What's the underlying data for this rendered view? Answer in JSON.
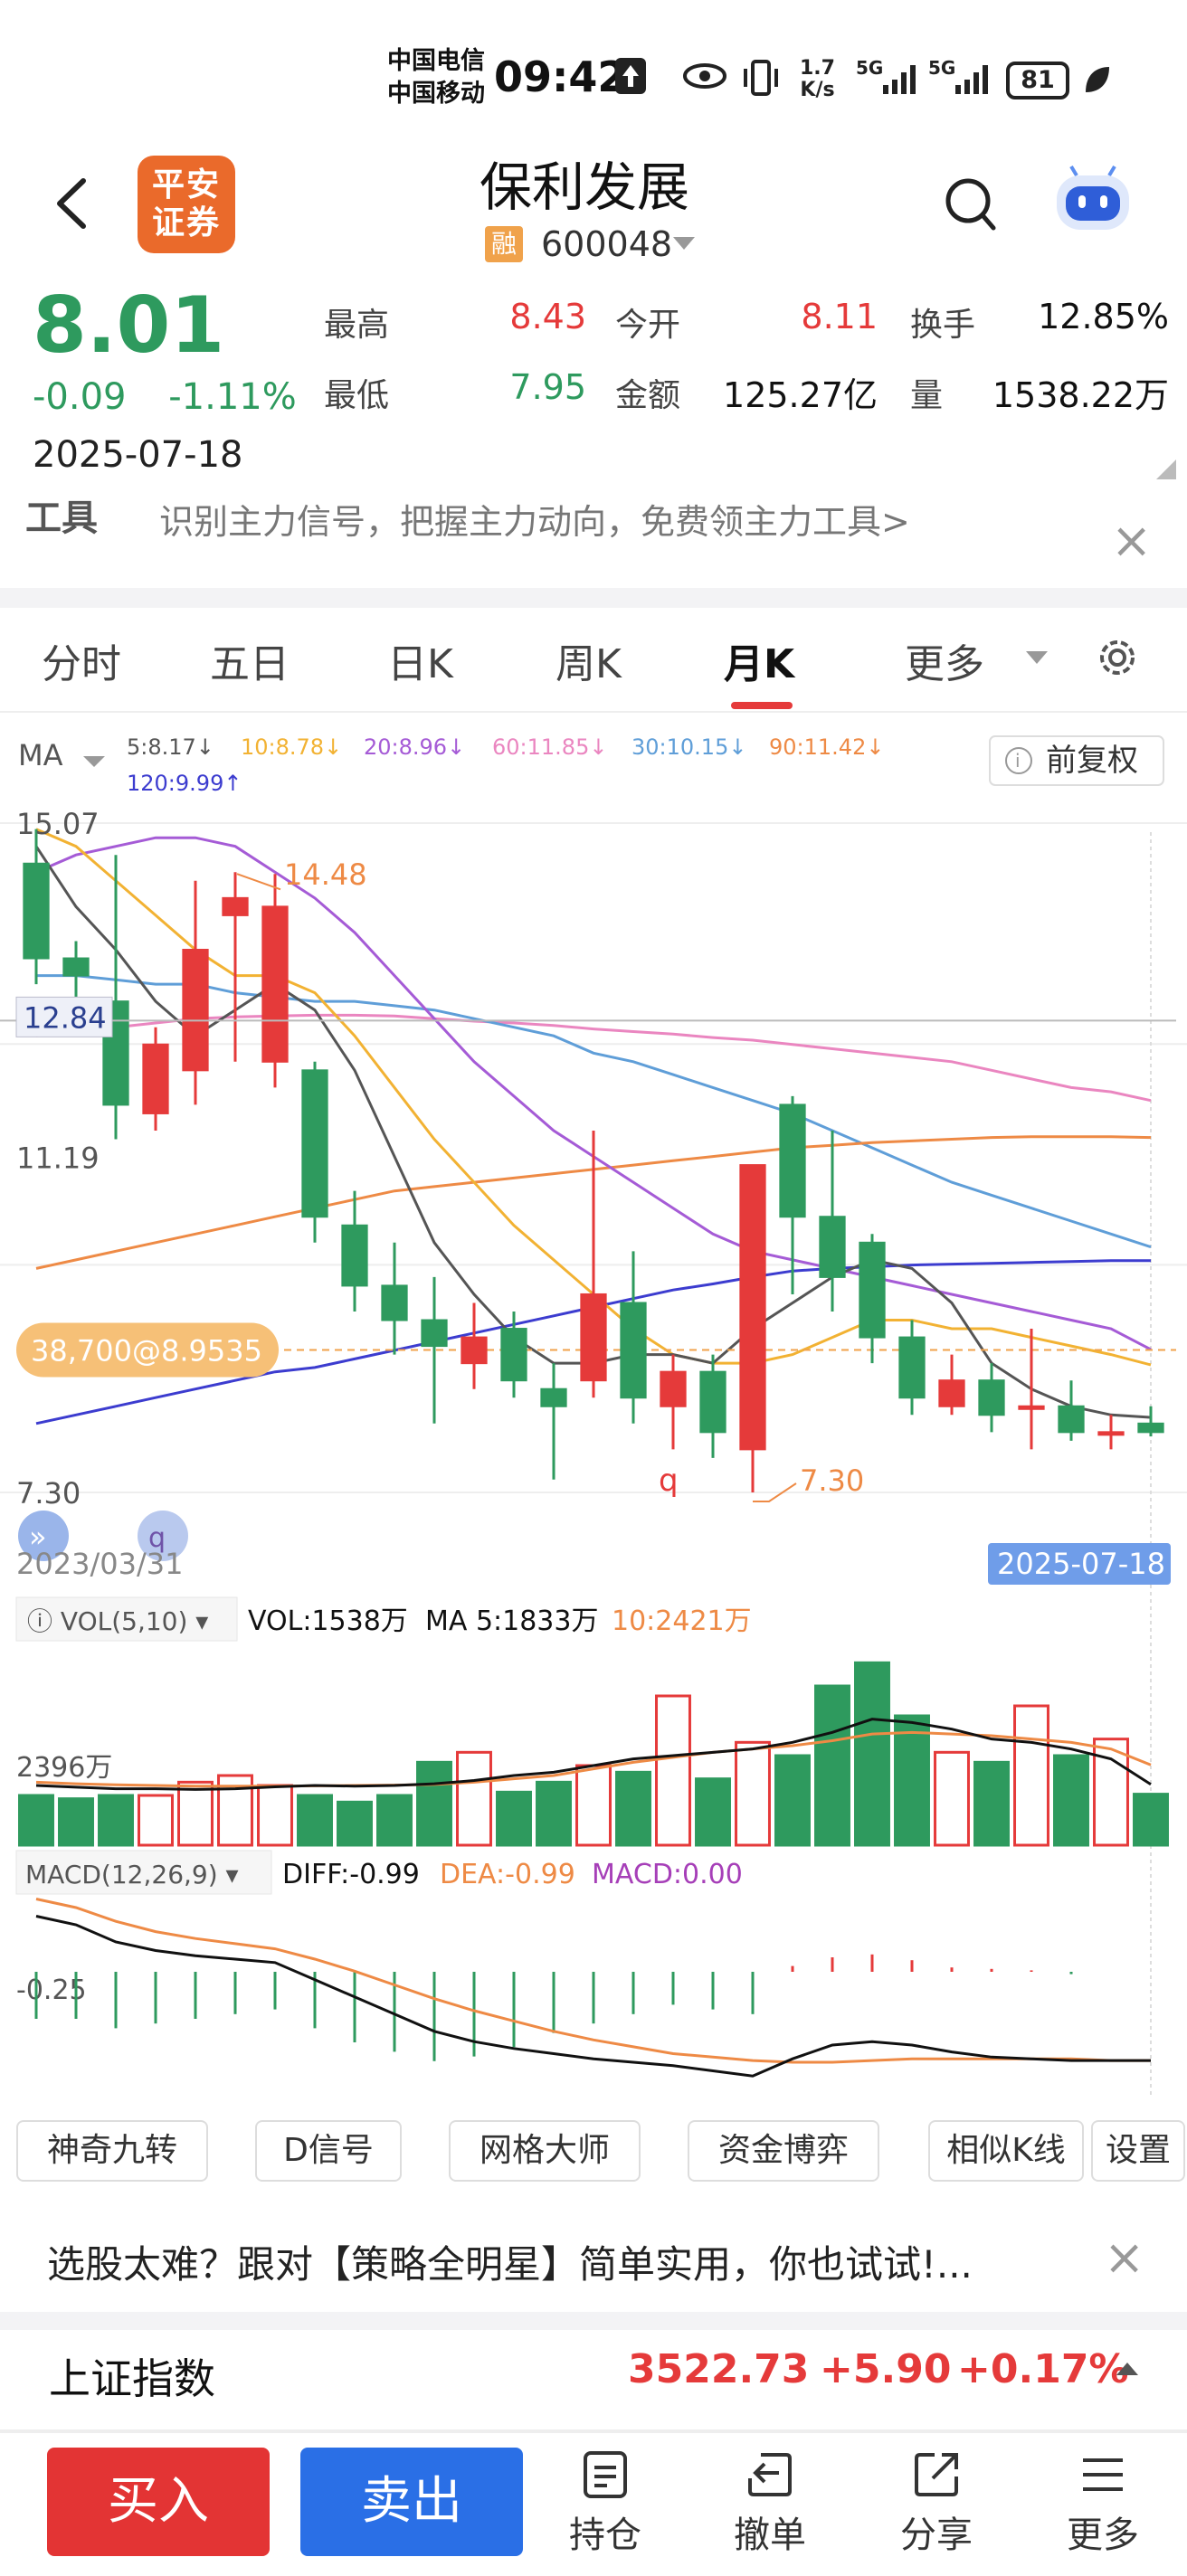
{
  "status_bar": {
    "carrier1": "中国电信",
    "carrier2": "中国移动",
    "time": "09:42",
    "net_speed_value": "1.7",
    "net_speed_unit": "K/s",
    "battery": "81",
    "icons": [
      "upload-icon",
      "eye-icon",
      "vibrate-icon",
      "signal-5g-icon",
      "signal-5g-icon",
      "battery-icon",
      "leaf-icon"
    ]
  },
  "header": {
    "broker_logo_line1": "平安",
    "broker_logo_line2": "证券",
    "stock_name": "保利发展",
    "margin_badge": "融",
    "stock_code": "600048"
  },
  "quote": {
    "price": "8.01",
    "change": "-0.09",
    "change_pct": "-1.11%",
    "date": "2025-07-18",
    "high_label": "最高",
    "high": "8.43",
    "low_label": "最低",
    "low": "7.95",
    "open_label": "今开",
    "open": "8.11",
    "amount_label": "金额",
    "amount": "125.27亿",
    "turnover_label": "换手",
    "turnover": "12.85%",
    "volume_label": "量",
    "volume": "1538.22万"
  },
  "promo": {
    "label": "工具",
    "text": "识别主力信号，把握主力动向，免费领主力工具>"
  },
  "tabs": [
    "分时",
    "五日",
    "日K",
    "周K",
    "月K",
    "更多"
  ],
  "active_tab": "月K",
  "chart_data": {
    "type": "candlestick",
    "period": "monthly",
    "ma_label": "MA",
    "ma_legend": [
      {
        "label": "5:8.17",
        "arrow": "↓",
        "color": "#555555"
      },
      {
        "label": "10:8.78",
        "arrow": "↓",
        "color": "#f2b233"
      },
      {
        "label": "20:8.96",
        "arrow": "↓",
        "color": "#a55bd6"
      },
      {
        "label": "60:11.85",
        "arrow": "↓",
        "color": "#ea86c0"
      },
      {
        "label": "30:10.15",
        "arrow": "↓",
        "color": "#5f9ed8"
      },
      {
        "label": "90:11.42",
        "arrow": "↓",
        "color": "#ee8a45"
      },
      {
        "label": "120:9.99",
        "arrow": "↑",
        "color": "#3c3ccf"
      }
    ],
    "fq_button": "前复权",
    "y_ticks": [
      "15.07",
      "11.19",
      "7.30"
    ],
    "ylim": [
      7.3,
      15.07
    ],
    "crosshair_value": "12.84",
    "marker_high": "14.48",
    "marker_low": "7.30",
    "cost_badge": "38,700@8.9535",
    "cost_price": 8.9535,
    "q_label": "q",
    "x_start": "2023/03/31",
    "x_end": "2025-07-18",
    "candles": [
      {
        "o": 14.6,
        "c": 13.5,
        "h": 15.0,
        "l": 13.2
      },
      {
        "o": 13.5,
        "c": 13.3,
        "h": 13.7,
        "l": 13.0
      },
      {
        "o": 13.0,
        "c": 11.8,
        "h": 14.7,
        "l": 11.4
      },
      {
        "o": 11.7,
        "c": 12.5,
        "h": 12.7,
        "l": 11.5
      },
      {
        "o": 12.2,
        "c": 13.6,
        "h": 14.4,
        "l": 11.8
      },
      {
        "o": 14.0,
        "c": 14.2,
        "h": 14.5,
        "l": 12.3
      },
      {
        "o": 12.3,
        "c": 14.1,
        "h": 14.48,
        "l": 12.0
      },
      {
        "o": 12.2,
        "c": 10.5,
        "h": 12.3,
        "l": 10.2
      },
      {
        "o": 10.4,
        "c": 9.7,
        "h": 10.8,
        "l": 9.4
      },
      {
        "o": 9.7,
        "c": 9.3,
        "h": 10.2,
        "l": 8.9
      },
      {
        "o": 9.3,
        "c": 9.0,
        "h": 9.8,
        "l": 8.1
      },
      {
        "o": 8.8,
        "c": 9.1,
        "h": 9.5,
        "l": 8.5
      },
      {
        "o": 9.2,
        "c": 8.6,
        "h": 9.4,
        "l": 8.4
      },
      {
        "o": 8.5,
        "c": 8.3,
        "h": 8.8,
        "l": 7.45
      },
      {
        "o": 8.6,
        "c": 9.6,
        "h": 11.5,
        "l": 8.4
      },
      {
        "o": 9.5,
        "c": 8.4,
        "h": 10.1,
        "l": 8.1
      },
      {
        "o": 8.3,
        "c": 8.7,
        "h": 8.9,
        "l": 7.8
      },
      {
        "o": 8.7,
        "c": 8.0,
        "h": 8.9,
        "l": 7.7
      },
      {
        "o": 7.8,
        "c": 11.1,
        "h": 11.1,
        "l": 7.3
      },
      {
        "o": 11.8,
        "c": 10.5,
        "h": 11.9,
        "l": 9.6
      },
      {
        "o": 10.5,
        "c": 9.8,
        "h": 11.5,
        "l": 9.4
      },
      {
        "o": 10.2,
        "c": 9.1,
        "h": 10.3,
        "l": 8.8
      },
      {
        "o": 9.1,
        "c": 8.4,
        "h": 9.3,
        "l": 8.2
      },
      {
        "o": 8.3,
        "c": 8.6,
        "h": 8.9,
        "l": 8.2
      },
      {
        "o": 8.6,
        "c": 8.2,
        "h": 8.8,
        "l": 8.0
      },
      {
        "o": 8.3,
        "c": 8.3,
        "h": 9.2,
        "l": 7.8
      },
      {
        "o": 8.3,
        "c": 8.0,
        "h": 8.6,
        "l": 7.9
      },
      {
        "o": 8.0,
        "c": 8.0,
        "h": 8.2,
        "l": 7.8
      },
      {
        "o": 8.1,
        "c": 8.0,
        "h": 8.3,
        "l": 7.95
      }
    ],
    "ma_lines": {
      "ma5": [
        14.8,
        14.1,
        13.6,
        13.0,
        12.6,
        12.9,
        13.2,
        12.9,
        12.2,
        11.2,
        10.2,
        9.6,
        9.1,
        8.8,
        8.8,
        8.9,
        8.9,
        8.8,
        9.2,
        9.5,
        9.8,
        10.0,
        9.9,
        9.5,
        8.8,
        8.5,
        8.3,
        8.2,
        8.17
      ],
      "ma10": [
        15.0,
        14.8,
        14.4,
        14.0,
        13.6,
        13.3,
        13.3,
        13.1,
        12.6,
        12.0,
        11.4,
        10.9,
        10.4,
        10.0,
        9.6,
        9.2,
        8.9,
        8.8,
        8.8,
        8.9,
        9.1,
        9.3,
        9.3,
        9.2,
        9.2,
        9.1,
        9.0,
        8.9,
        8.78
      ],
      "ma20": [
        14.5,
        14.7,
        14.8,
        14.9,
        14.9,
        14.8,
        14.5,
        14.2,
        13.8,
        13.3,
        12.8,
        12.3,
        11.9,
        11.5,
        11.2,
        10.9,
        10.6,
        10.3,
        10.1,
        10.0,
        9.9,
        9.8,
        9.7,
        9.6,
        9.5,
        9.4,
        9.3,
        9.2,
        8.96
      ],
      "ma30": [
        13.3,
        13.3,
        13.25,
        13.2,
        13.2,
        13.1,
        13.05,
        13.0,
        13.0,
        12.95,
        12.9,
        12.8,
        12.7,
        12.6,
        12.4,
        12.3,
        12.15,
        12.0,
        11.85,
        11.7,
        11.5,
        11.3,
        11.1,
        10.9,
        10.75,
        10.6,
        10.45,
        10.3,
        10.15
      ],
      "ma60": [
        12.6,
        12.65,
        12.7,
        12.75,
        12.8,
        12.82,
        12.83,
        12.84,
        12.84,
        12.83,
        12.8,
        12.77,
        12.75,
        12.72,
        12.68,
        12.65,
        12.62,
        12.58,
        12.55,
        12.5,
        12.45,
        12.4,
        12.35,
        12.3,
        12.2,
        12.1,
        12.0,
        11.95,
        11.85
      ],
      "ma90": [
        9.9,
        10.0,
        10.1,
        10.2,
        10.3,
        10.4,
        10.5,
        10.6,
        10.7,
        10.8,
        10.85,
        10.9,
        10.95,
        11.0,
        11.05,
        11.1,
        11.15,
        11.2,
        11.25,
        11.3,
        11.33,
        11.36,
        11.38,
        11.4,
        11.42,
        11.43,
        11.43,
        11.43,
        11.42
      ],
      "ma120": [
        8.1,
        8.2,
        8.3,
        8.4,
        8.5,
        8.6,
        8.7,
        8.75,
        8.85,
        8.95,
        9.05,
        9.15,
        9.25,
        9.35,
        9.45,
        9.55,
        9.65,
        9.72,
        9.8,
        9.87,
        9.9,
        9.92,
        9.94,
        9.95,
        9.96,
        9.97,
        9.98,
        9.99,
        9.99
      ]
    },
    "volume": {
      "indicator": "VOL(5,10)",
      "legend_vol": "VOL:1538万",
      "legend_ma5": "MA 5:1833万",
      "legend_ma10": "10:2421万",
      "y_tick": "2396万",
      "values": [
        1500,
        1400,
        1500,
        1500,
        1900,
        2100,
        1800,
        1500,
        1300,
        1500,
        2500,
        2800,
        1600,
        1900,
        2400,
        2200,
        4500,
        2000,
        3100,
        2700,
        4800,
        5500,
        3900,
        2800,
        2500,
        4200,
        2700,
        3200,
        1538
      ],
      "ma5": [
        1800,
        1750,
        1700,
        1700,
        1680,
        1700,
        1760,
        1800,
        1780,
        1800,
        1850,
        1950,
        2100,
        2200,
        2400,
        2600,
        2700,
        2800,
        2900,
        3100,
        3400,
        3800,
        3700,
        3500,
        3200,
        3100,
        2900,
        2600,
        1833
      ],
      "ma10": [
        1900,
        1850,
        1820,
        1800,
        1780,
        1780,
        1780,
        1790,
        1800,
        1810,
        1830,
        1900,
        2000,
        2100,
        2300,
        2500,
        2650,
        2800,
        2900,
        3000,
        3150,
        3350,
        3400,
        3350,
        3300,
        3200,
        3100,
        2900,
        2421
      ]
    },
    "macd": {
      "indicator": "MACD(12,26,9)",
      "legend_diff": "DIFF:-0.99",
      "legend_dea": "DEA:-0.99",
      "legend_macd": "MACD:0.00",
      "y_tick": "-0.25",
      "diff": [
        -0.15,
        -0.2,
        -0.3,
        -0.35,
        -0.38,
        -0.4,
        -0.42,
        -0.52,
        -0.62,
        -0.72,
        -0.82,
        -0.88,
        -0.92,
        -0.95,
        -0.98,
        -1.0,
        -1.02,
        -1.05,
        -1.08,
        -0.98,
        -0.9,
        -0.88,
        -0.9,
        -0.94,
        -0.97,
        -0.98,
        -0.99,
        -0.99,
        -0.99
      ],
      "dea": [
        -0.05,
        -0.1,
        -0.18,
        -0.24,
        -0.28,
        -0.31,
        -0.34,
        -0.4,
        -0.47,
        -0.55,
        -0.63,
        -0.7,
        -0.76,
        -0.82,
        -0.87,
        -0.91,
        -0.95,
        -0.97,
        -0.99,
        -1.0,
        -1.0,
        -0.99,
        -0.98,
        -0.98,
        -0.98,
        -0.98,
        -0.98,
        -0.99,
        -0.99
      ],
      "hist": [
        -0.2,
        -0.2,
        -0.24,
        -0.22,
        -0.2,
        -0.18,
        -0.16,
        -0.24,
        -0.3,
        -0.34,
        -0.38,
        -0.36,
        -0.32,
        -0.26,
        -0.22,
        -0.18,
        -0.14,
        -0.16,
        -0.18,
        0.04,
        0.1,
        0.12,
        0.08,
        0.03,
        0.02,
        0.01,
        -0.01,
        0.0,
        0.0
      ]
    }
  },
  "tool_buttons": [
    "神奇九转",
    "D信号",
    "网格大师",
    "资金博弈",
    "相似K线",
    "设置"
  ],
  "promo2": {
    "text": "选股太难？跟对【策略全明星】简单实用，你也试试!..."
  },
  "index": {
    "name": "上证指数",
    "value": "3522.73",
    "change": "+5.90",
    "change_pct": "+0.17%"
  },
  "bottom_nav": {
    "buy": "买入",
    "sell": "卖出",
    "items": [
      {
        "label": "持仓",
        "icon": "holdings-icon"
      },
      {
        "label": "撤单",
        "icon": "cancel-order-icon"
      },
      {
        "label": "分享",
        "icon": "share-icon"
      },
      {
        "label": "更多",
        "icon": "more-icon"
      }
    ]
  },
  "colors": {
    "up": "#e53a3a",
    "down": "#2e9a5e",
    "accent": "#e53a3a",
    "sell_blue": "#2a6fe6",
    "brand_orange": "#ea6a2b"
  }
}
